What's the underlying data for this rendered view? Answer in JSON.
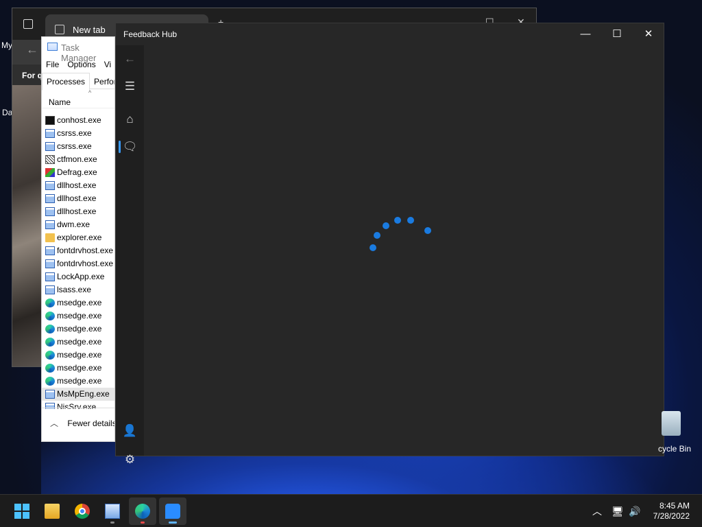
{
  "desktop": {
    "label_top_left": "My",
    "label_mid_left": "Da",
    "recycle_bin_label": "cycle Bin"
  },
  "browser": {
    "tab_title": "New tab",
    "banner_text": "For q"
  },
  "task_manager": {
    "title": "Task Manager",
    "menu": [
      "File",
      "Options",
      "Vi"
    ],
    "tabs": [
      "Processes",
      "Perforr"
    ],
    "column_header": "Name",
    "processes": [
      {
        "name": "conhost.exe",
        "icon": "cmd"
      },
      {
        "name": "csrss.exe",
        "icon": "win"
      },
      {
        "name": "csrss.exe",
        "icon": "win"
      },
      {
        "name": "ctfmon.exe",
        "icon": "ctf"
      },
      {
        "name": "Defrag.exe",
        "icon": "defrag"
      },
      {
        "name": "dllhost.exe",
        "icon": "win"
      },
      {
        "name": "dllhost.exe",
        "icon": "win"
      },
      {
        "name": "dllhost.exe",
        "icon": "win"
      },
      {
        "name": "dwm.exe",
        "icon": "win"
      },
      {
        "name": "explorer.exe",
        "icon": "folder"
      },
      {
        "name": "fontdrvhost.exe",
        "icon": "win"
      },
      {
        "name": "fontdrvhost.exe",
        "icon": "win"
      },
      {
        "name": "LockApp.exe",
        "icon": "win"
      },
      {
        "name": "lsass.exe",
        "icon": "win"
      },
      {
        "name": "msedge.exe",
        "icon": "edge"
      },
      {
        "name": "msedge.exe",
        "icon": "edge"
      },
      {
        "name": "msedge.exe",
        "icon": "edge"
      },
      {
        "name": "msedge.exe",
        "icon": "edge"
      },
      {
        "name": "msedge.exe",
        "icon": "edge"
      },
      {
        "name": "msedge.exe",
        "icon": "edge"
      },
      {
        "name": "msedge.exe",
        "icon": "edge"
      },
      {
        "name": "MsMpEng.exe",
        "icon": "win",
        "selected": true
      },
      {
        "name": "NisSrv.exe",
        "icon": "win"
      }
    ],
    "fewer_details_label": "Fewer details"
  },
  "feedback_hub": {
    "title": "Feedback Hub",
    "nav": [
      "back-arrow-icon",
      "menu-icon",
      "home-icon",
      "feedback-icon",
      "add-user-icon",
      "settings-icon"
    ],
    "accent": "#1a7be0"
  },
  "taskbar": {
    "apps": [
      "start-icon",
      "file-explorer-icon",
      "chrome-icon",
      "task-manager-icon",
      "edge-icon",
      "feedback-hub-icon"
    ],
    "time": "8:45 AM",
    "date": "7/28/2022"
  }
}
